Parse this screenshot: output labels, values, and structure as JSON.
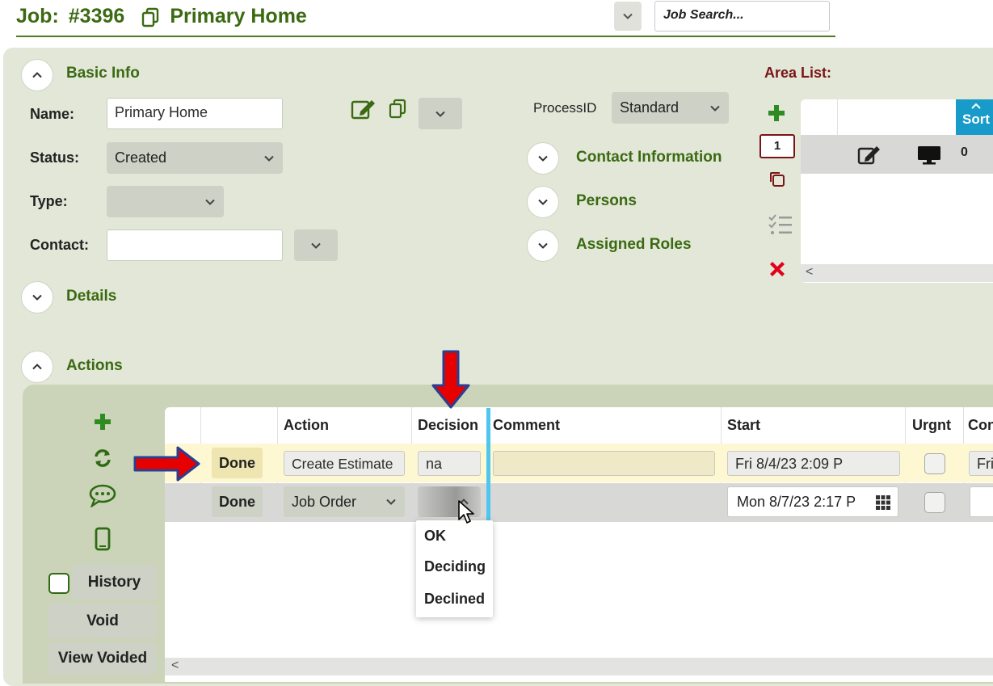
{
  "header": {
    "job_label": "Job:",
    "job_number": "#3396",
    "job_name": "Primary Home",
    "search_placeholder": "Job Search..."
  },
  "basic_info": {
    "title": "Basic Info",
    "name_label": "Name:",
    "name_value": "Primary Home",
    "status_label": "Status:",
    "status_value": "Created",
    "type_label": "Type:",
    "type_value": "",
    "contact_label": "Contact:",
    "contact_value": "",
    "process_label": "ProcessID",
    "process_value": "Standard"
  },
  "sections": {
    "contact_information": "Contact Information",
    "persons": "Persons",
    "assigned_roles": "Assigned Roles",
    "details": "Details",
    "actions": "Actions"
  },
  "area_list": {
    "title": "Area List:",
    "count": "1",
    "sort_label": "Sort",
    "row_value": "0"
  },
  "actions_side": {
    "history_label": "History",
    "void_label": "Void",
    "view_voided_label": "View Voided"
  },
  "actions_grid": {
    "columns": [
      "Action",
      "Decision",
      "Comment",
      "Start",
      "Urgnt",
      "Con"
    ],
    "rows": [
      {
        "status": "Done",
        "action": "Create Estimate",
        "decision": "na",
        "comment": "",
        "start": "Fri 8/4/23 2:09 P",
        "con": "Fri"
      },
      {
        "status": "Done",
        "action": "Job Order",
        "decision": "",
        "comment": "",
        "start": "Mon 8/7/23 2:17 P",
        "con": ""
      }
    ],
    "decision_options": [
      "OK",
      "Deciding",
      "Declined"
    ]
  },
  "colors": {
    "brand_green": "#3b6a12",
    "panel_bg": "#e2e7d8",
    "actions_bg": "#cbd4b8",
    "sort_blue": "#199bc9",
    "annotation_red": "#e60000",
    "annotation_blue": "#2a3f8f"
  }
}
